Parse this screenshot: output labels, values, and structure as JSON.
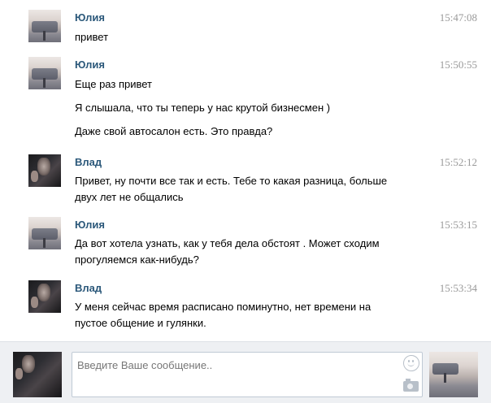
{
  "messages": [
    {
      "author": "Юлия",
      "avatar": "female-avatar",
      "time": "15:47:08",
      "lines": [
        "привет"
      ]
    },
    {
      "author": "Юлия",
      "avatar": "female-avatar",
      "time": "15:50:55",
      "lines": [
        "Еще раз привет",
        "Я слышала, что ты теперь у нас крутой бизнесмен )",
        "Даже свой автосалон есть. Это правда?"
      ]
    },
    {
      "author": "Влад",
      "avatar": "male-avatar",
      "time": "15:52:12",
      "lines": [
        "Привет, ну почти все так и есть. Тебе то какая разница, больше",
        "двух лет не общались"
      ]
    },
    {
      "author": "Юлия",
      "avatar": "female-avatar",
      "time": "15:53:15",
      "lines": [
        "Да вот хотела узнать, как у тебя дела обстоят . Может сходим",
        "прогуляемся как-нибудь?"
      ]
    },
    {
      "author": "Влад",
      "avatar": "male-avatar",
      "time": "15:53:34",
      "lines": [
        "У меня сейчас время расписано поминутно, нет времени на",
        "пустое общение и гулянки."
      ]
    }
  ],
  "composer": {
    "placeholder": "Введите Ваше сообщение..",
    "smile_icon": "smile-icon",
    "camera_icon": "camera-icon"
  },
  "colors": {
    "author": "#2b587a",
    "time": "#999999",
    "composer_bg": "#eef0f3"
  }
}
